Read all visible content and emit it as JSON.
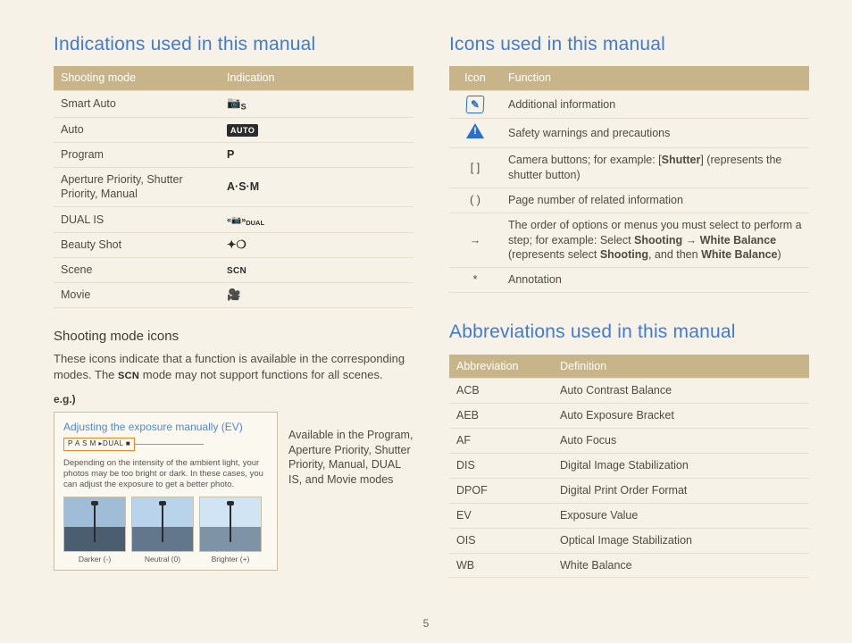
{
  "left": {
    "heading": "Indications used in this manual",
    "table": {
      "th1": "Shooting mode",
      "th2": "Indication",
      "rows": [
        {
          "mode": "Smart Auto",
          "ind": "S",
          "ind_type": "camera-s"
        },
        {
          "mode": "Auto",
          "ind": "AUTO",
          "ind_type": "auto-badge"
        },
        {
          "mode": "Program",
          "ind": "P",
          "ind_type": "bold"
        },
        {
          "mode": "Aperture Priority, Shutter Priority, Manual",
          "ind": "A·S·M",
          "ind_type": "bold"
        },
        {
          "mode": "DUAL IS",
          "ind": "DUAL",
          "ind_type": "dual"
        },
        {
          "mode": "Beauty Shot",
          "ind": "✦",
          "ind_type": "beauty"
        },
        {
          "mode": "Scene",
          "ind": "SCN",
          "ind_type": "scn"
        },
        {
          "mode": "Movie",
          "ind": "🎥",
          "ind_type": "movie"
        }
      ]
    },
    "sub_heading": "Shooting mode icons",
    "sub_text_a": "These icons indicate that a function is available in the corresponding modes. The ",
    "sub_text_scn": "SCN",
    "sub_text_b": " mode may not support functions for all scenes.",
    "eg_label": "e.g.)",
    "callout": {
      "title": "Adjusting the exposure manually (EV)",
      "modes_strip": "P A S M  ▸DUAL  ■",
      "body": "Depending on the intensity of the ambient light, your photos may be too bright or dark. In these cases, you can adjust the exposure to get a better photo.",
      "thumbs": [
        {
          "cap": "Darker (-)"
        },
        {
          "cap": "Neutral (0)"
        },
        {
          "cap": "Brighter (+)"
        }
      ]
    },
    "eg_note": "Available in the Program, Aperture Priority, Shutter Priority, Manual, DUAL IS, and Movie modes"
  },
  "right": {
    "icons_heading": "Icons used in this manual",
    "icons_table": {
      "th1": "Icon",
      "th2": "Function",
      "rows": [
        {
          "icon": "info",
          "text": "Additional information"
        },
        {
          "icon": "warn",
          "text": "Safety warnings and precautions"
        },
        {
          "icon": "[ ]",
          "text_a": "Camera buttons; for example: [",
          "bold": "Shutter",
          "text_b": "] (represents the shutter button)"
        },
        {
          "icon": "( )",
          "text": "Page number of related information"
        },
        {
          "icon": "→",
          "text_a": "The order of options or menus you must select to perform a step; for example: Select ",
          "b1": "Shooting",
          "arrow": " → ",
          "b2": "White Balance",
          "text_b": " (represents select ",
          "b3": "Shooting",
          "text_c": ", and then ",
          "b4": "White Balance",
          "text_d": ")"
        },
        {
          "icon": "*",
          "text": "Annotation"
        }
      ]
    },
    "abbr_heading": "Abbreviations used in this manual",
    "abbr_table": {
      "th1": "Abbreviation",
      "th2": "Definition",
      "rows": [
        {
          "a": "ACB",
          "d": "Auto Contrast Balance"
        },
        {
          "a": "AEB",
          "d": "Auto Exposure Bracket"
        },
        {
          "a": "AF",
          "d": "Auto Focus"
        },
        {
          "a": "DIS",
          "d": "Digital Image Stabilization"
        },
        {
          "a": "DPOF",
          "d": "Digital Print Order Format"
        },
        {
          "a": "EV",
          "d": "Exposure Value"
        },
        {
          "a": "OIS",
          "d": "Optical Image Stabilization"
        },
        {
          "a": "WB",
          "d": "White Balance"
        }
      ]
    }
  },
  "page_number": "5"
}
